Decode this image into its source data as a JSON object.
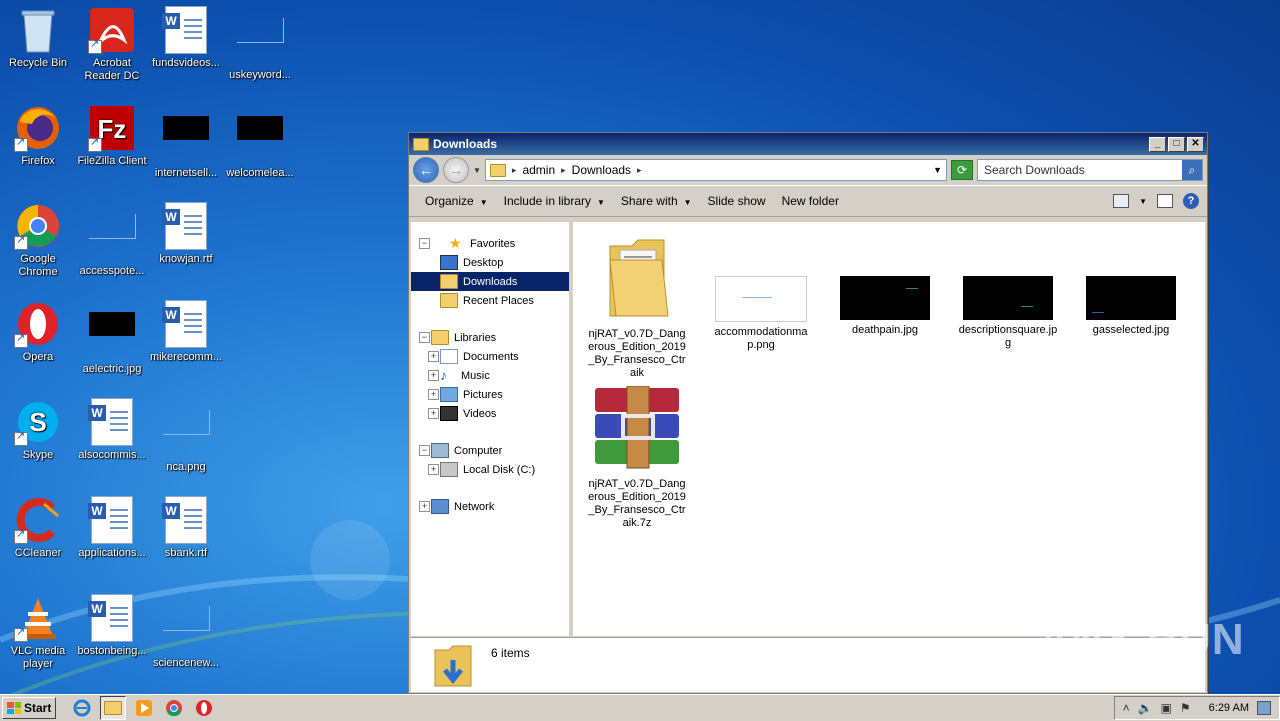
{
  "desktop": {
    "icons": [
      {
        "label": "Recycle Bin"
      },
      {
        "label": "Acrobat Reader DC"
      },
      {
        "label": "fundsvideos..."
      },
      {
        "label": "uskeyword..."
      },
      {
        "label": "Firefox"
      },
      {
        "label": "FileZilla Client"
      },
      {
        "label": "internetsell..."
      },
      {
        "label": "welcomelea..."
      },
      {
        "label": "Google Chrome"
      },
      {
        "label": "accesspote..."
      },
      {
        "label": "knowjan.rtf"
      },
      {
        "label": "Opera"
      },
      {
        "label": "aelectric.jpg"
      },
      {
        "label": "mikerecomm..."
      },
      {
        "label": "Skype"
      },
      {
        "label": "alsocommis..."
      },
      {
        "label": "nca.png"
      },
      {
        "label": "CCleaner"
      },
      {
        "label": "applications..."
      },
      {
        "label": "sbank.rtf"
      },
      {
        "label": "VLC media player"
      },
      {
        "label": "bostonbeing..."
      },
      {
        "label": "sciencenew..."
      }
    ]
  },
  "window": {
    "title": "Downloads",
    "address": {
      "crumbs": [
        "admin",
        "Downloads"
      ]
    },
    "search_placeholder": "Search Downloads",
    "toolbar": {
      "organize": "Organize",
      "include": "Include in library",
      "share": "Share with",
      "slideshow": "Slide show",
      "newfolder": "New folder"
    },
    "nav": {
      "favorites": "Favorites",
      "desktop": "Desktop",
      "downloads": "Downloads",
      "recent": "Recent Places",
      "libraries": "Libraries",
      "documents": "Documents",
      "music": "Music",
      "pictures": "Pictures",
      "videos": "Videos",
      "computer": "Computer",
      "localdisk": "Local Disk (C:)",
      "network": "Network"
    },
    "files": [
      {
        "name": "njRAT_v0.7D_Dangerous_Edition_2019_By_Fransesco_Ctraik"
      },
      {
        "name": "accommodationmap.png"
      },
      {
        "name": "deathpain.jpg"
      },
      {
        "name": "descriptionsquare.jpg"
      },
      {
        "name": "gasselected.jpg"
      },
      {
        "name": "njRAT_v0.7D_Dangerous_Edition_2019_By_Fransesco_Ctraik.7z"
      }
    ],
    "status": "6 items"
  },
  "taskbar": {
    "start": "Start",
    "clock": "6:29 AM"
  },
  "watermark": "ANY RUN"
}
